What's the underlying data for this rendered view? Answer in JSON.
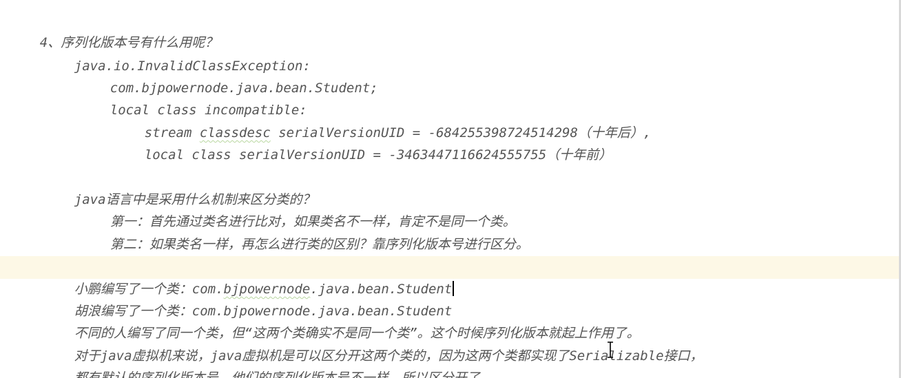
{
  "editor": {
    "lines": [
      {
        "segments": [
          {
            "text": "4、序列化版本号有什么用呢？"
          }
        ]
      },
      {
        "segments": [
          {
            "text": "java.io.InvalidClassException:"
          }
        ]
      },
      {
        "segments": [
          {
            "text": "com.bjpowernode.java.bean.Student;"
          }
        ]
      },
      {
        "segments": [
          {
            "text": "local class incompatible:"
          }
        ]
      },
      {
        "segments": [
          {
            "text": "stream "
          },
          {
            "text": "classdesc",
            "squiggle": true
          },
          {
            "text": " serialVersionUID = -684255398724514298（十年后）,"
          }
        ]
      },
      {
        "segments": [
          {
            "text": "local class serialVersionUID = -3463447116624555755（十年前）"
          }
        ]
      },
      {
        "segments": [
          {
            "text": "java语言中是采用什么机制来区分类的？"
          }
        ]
      },
      {
        "segments": [
          {
            "text": "第一：首先通过类名进行比对，如果类名不一样，肯定不是同一个类。"
          }
        ]
      },
      {
        "segments": [
          {
            "text": "第二：如果类名一样，再怎么进行类的区别？靠序列化版本号进行区分。"
          }
        ]
      },
      {
        "segments": [
          {
            "text": "小鹏编写了一个类：com."
          },
          {
            "text": "bjpowernode",
            "squiggle": true
          },
          {
            "text": ".java.bean.Student"
          }
        ]
      },
      {
        "segments": [
          {
            "text": "胡浪编写了一个类：com.bjpowernode.java.bean.Student"
          }
        ]
      },
      {
        "segments": [
          {
            "text": "不同的人编写了同一个类，但“这两个类确实不是同一个类”。这个时候序列化版本就起上作用了。"
          }
        ]
      },
      {
        "segments": [
          {
            "text": "对于java虚拟机来说，java虚拟机是可以区分开这两个类的，因为这两个类都实现了Serializable接口，"
          }
        ]
      },
      {
        "segments": [
          {
            "text": "都有默认的序列化版本号，他们的序列化版本号不一样。所以区分开了。"
          }
        ]
      }
    ]
  }
}
